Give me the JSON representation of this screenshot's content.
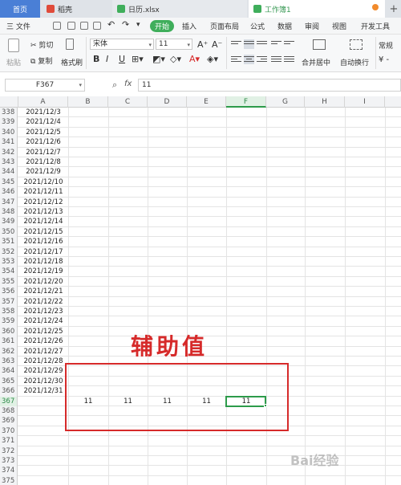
{
  "tabs": {
    "home": "首页",
    "t1": "稻壳",
    "t2": "日历.xlsx",
    "t3": "工作簿1",
    "plus": "+"
  },
  "menu": {
    "file": "三 文件",
    "start": "开始",
    "insert": "插入",
    "layout": "页面布局",
    "formula": "公式",
    "data": "数据",
    "review": "审阅",
    "view": "视图",
    "dev": "开发工具"
  },
  "ribbon": {
    "paste": "粘贴",
    "cut": "剪切",
    "copy": "复制",
    "format_painter": "格式刷",
    "font_name": "宋体",
    "font_size": "11",
    "grow": "A⁺",
    "shrink": "A⁻",
    "bold": "B",
    "italic": "I",
    "underline": "U",
    "merge": "合并居中",
    "wrap": "自动换行",
    "normal": "常规",
    "currency": "¥ -"
  },
  "formula_bar": {
    "name_box": "F367",
    "fx": "fx",
    "value": "11"
  },
  "columns": [
    "A",
    "B",
    "C",
    "D",
    "E",
    "F",
    "G",
    "H",
    "I"
  ],
  "rows": [
    {
      "n": "338",
      "a": "2021/12/3"
    },
    {
      "n": "339",
      "a": "2021/12/4"
    },
    {
      "n": "340",
      "a": "2021/12/5"
    },
    {
      "n": "341",
      "a": "2021/12/6"
    },
    {
      "n": "342",
      "a": "2021/12/7"
    },
    {
      "n": "343",
      "a": "2021/12/8"
    },
    {
      "n": "344",
      "a": "2021/12/9"
    },
    {
      "n": "345",
      "a": "2021/12/10"
    },
    {
      "n": "346",
      "a": "2021/12/11"
    },
    {
      "n": "347",
      "a": "2021/12/12"
    },
    {
      "n": "348",
      "a": "2021/12/13"
    },
    {
      "n": "349",
      "a": "2021/12/14"
    },
    {
      "n": "350",
      "a": "2021/12/15"
    },
    {
      "n": "351",
      "a": "2021/12/16"
    },
    {
      "n": "352",
      "a": "2021/12/17"
    },
    {
      "n": "353",
      "a": "2021/12/18"
    },
    {
      "n": "354",
      "a": "2021/12/19"
    },
    {
      "n": "355",
      "a": "2021/12/20"
    },
    {
      "n": "356",
      "a": "2021/12/21"
    },
    {
      "n": "357",
      "a": "2021/12/22"
    },
    {
      "n": "358",
      "a": "2021/12/23"
    },
    {
      "n": "359",
      "a": "2021/12/24"
    },
    {
      "n": "360",
      "a": "2021/12/25"
    },
    {
      "n": "361",
      "a": "2021/12/26"
    },
    {
      "n": "362",
      "a": "2021/12/27"
    },
    {
      "n": "363",
      "a": "2021/12/28"
    },
    {
      "n": "364",
      "a": "2021/12/29"
    },
    {
      "n": "365",
      "a": "2021/12/30"
    },
    {
      "n": "366",
      "a": "2021/12/31"
    },
    {
      "n": "367",
      "a": ""
    },
    {
      "n": "368",
      "a": ""
    },
    {
      "n": "369",
      "a": ""
    },
    {
      "n": "370",
      "a": ""
    },
    {
      "n": "371",
      "a": ""
    },
    {
      "n": "372",
      "a": ""
    },
    {
      "n": "373",
      "a": ""
    },
    {
      "n": "374",
      "a": ""
    },
    {
      "n": "375",
      "a": ""
    }
  ],
  "helper_values": {
    "b": "11",
    "c": "11",
    "d": "11",
    "e": "11",
    "f": "11"
  },
  "annotation": "辅助值",
  "watermark": "Bai经验",
  "colors": {
    "accent": "#3fae5b",
    "annotation": "#d62a2a",
    "home_tab": "#4a7fd6"
  }
}
